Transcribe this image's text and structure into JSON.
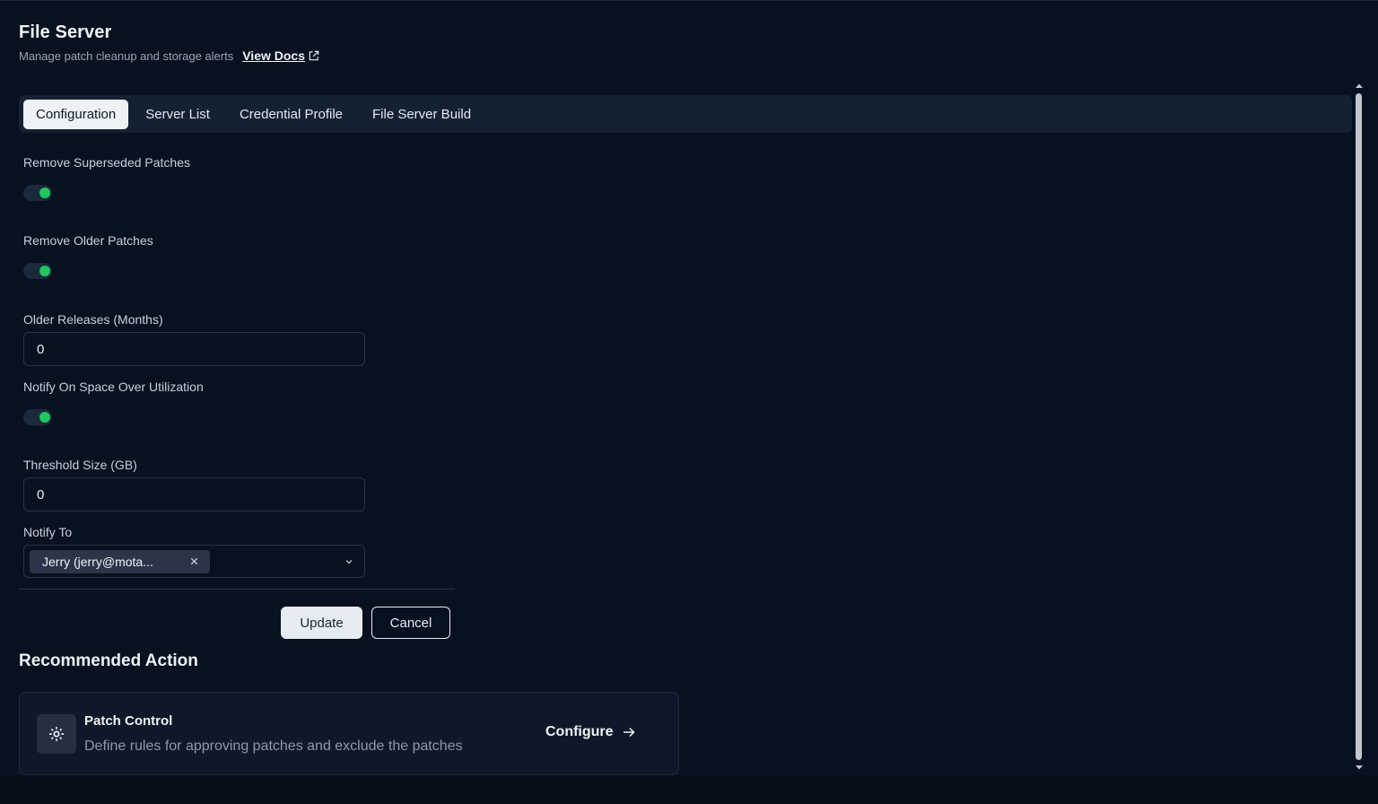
{
  "header": {
    "title": "File Server",
    "subtitle": "Manage patch cleanup and storage alerts",
    "docs_link": "View Docs"
  },
  "tabs": [
    {
      "label": "Configuration",
      "active": true
    },
    {
      "label": "Server List",
      "active": false
    },
    {
      "label": "Credential Profile",
      "active": false
    },
    {
      "label": "File Server Build",
      "active": false
    }
  ],
  "form": {
    "remove_superseded": {
      "label": "Remove Superseded Patches",
      "enabled": true
    },
    "remove_older": {
      "label": "Remove Older Patches",
      "enabled": true
    },
    "older_releases": {
      "label": "Older Releases (Months)",
      "value": "0"
    },
    "notify_space": {
      "label": "Notify On Space Over Utilization",
      "enabled": true
    },
    "threshold": {
      "label": "Threshold Size (GB)",
      "value": "0"
    },
    "notify_to": {
      "label": "Notify To",
      "selected": "Jerry (jerry@mota..."
    }
  },
  "actions": {
    "update": "Update",
    "cancel": "Cancel"
  },
  "recommended": {
    "title": "Recommended Action",
    "card_title": "Patch Control",
    "card_desc": "Define rules for approving patches and exclude the patches",
    "card_action": "Configure"
  },
  "colors": {
    "background": "#07111f",
    "toggle_on": "#22c55e",
    "tab_bar": "#142133"
  }
}
